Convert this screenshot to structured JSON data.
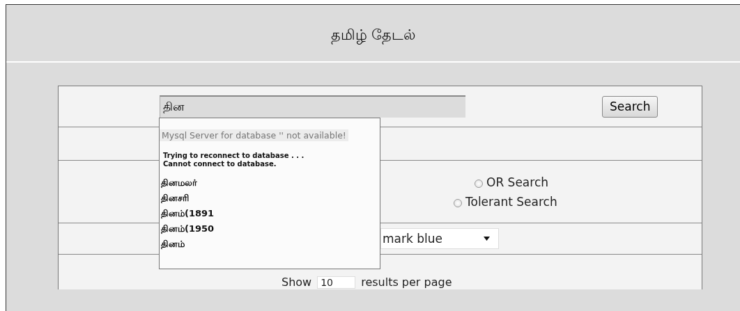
{
  "title": "தமிழ் தேடல்",
  "search": {
    "value": "தின",
    "button": "Search"
  },
  "suggestions": {
    "error": "Mysql Server for database '' not available!",
    "messages": [
      "Trying to reconnect to database . . .",
      "Cannot connect to database."
    ],
    "items": [
      "தினமலர்",
      "தினசரி",
      "தினம்(1891",
      "தினம்(1950",
      "தினம்"
    ]
  },
  "options": [
    {
      "label": "OR Search",
      "selected": false
    },
    {
      "label": "Tolerant Search",
      "selected": false
    }
  ],
  "highlight": {
    "value": "mark blue"
  },
  "paging": {
    "prefix": "Show",
    "value": "10",
    "suffix": "results per page"
  }
}
